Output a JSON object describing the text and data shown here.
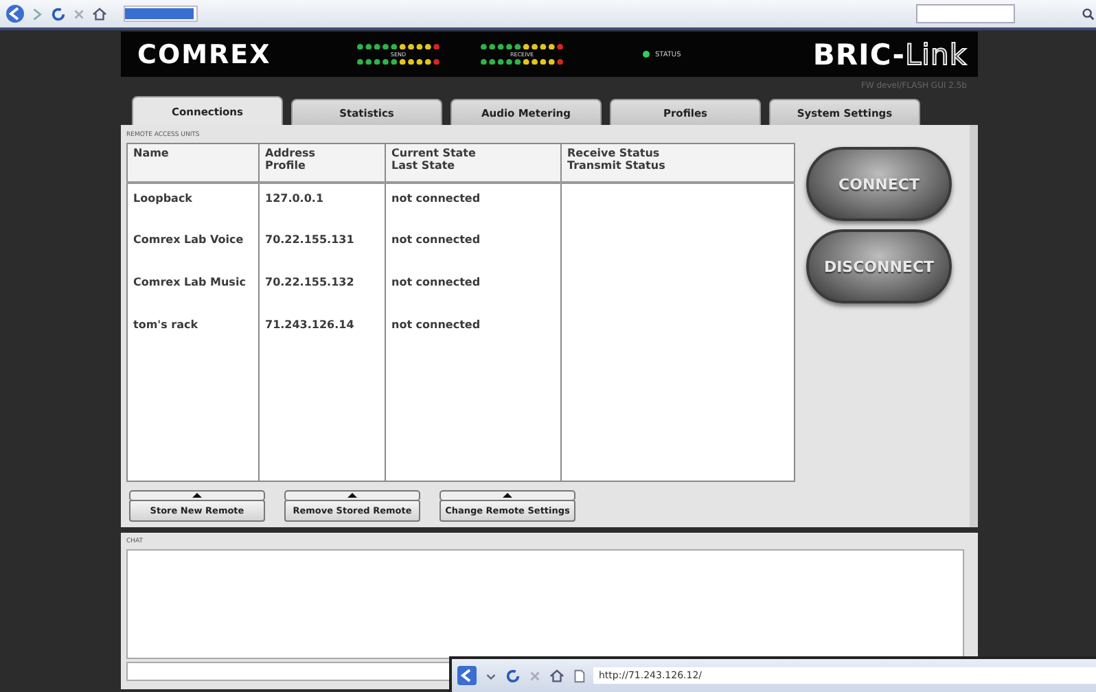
{
  "header": {
    "left_logo": "COMREX",
    "right_logo_main": "BRIC-",
    "right_logo_tail": "Link",
    "meters": [
      {
        "label": "SEND"
      },
      {
        "label": "RECEIVE"
      }
    ],
    "status": {
      "label": "STATUS",
      "on": true
    }
  },
  "version": "FW devel/FLASH GUI 2.5b",
  "tabs": [
    {
      "label": "Connections",
      "selected": true
    },
    {
      "label": "Statistics",
      "selected": false
    },
    {
      "label": "Audio Metering",
      "selected": false
    },
    {
      "label": "Profiles",
      "selected": false
    },
    {
      "label": "System Settings",
      "selected": false
    }
  ],
  "remote_units": {
    "title": "REMOTE ACCESS UNITS",
    "columns": [
      {
        "lines": [
          "Name"
        ]
      },
      {
        "lines": [
          "Address",
          "Profile"
        ]
      },
      {
        "lines": [
          "Current State",
          "Last State"
        ]
      },
      {
        "lines": [
          "Receive Status",
          "Transmit Status"
        ]
      }
    ],
    "rows": [
      {
        "cells": [
          "Loopback",
          "127.0.0.1",
          "not connected"
        ]
      },
      {
        "cells": [
          "Comrex Lab Voice",
          "70.22.155.131",
          "not connected"
        ]
      },
      {
        "cells": [
          "Comrex Lab Music",
          "70.22.155.132",
          "not connected"
        ]
      },
      {
        "cells": [
          "tom's rack",
          "71.243.126.14",
          "not connected"
        ]
      }
    ]
  },
  "connect_buttons": [
    "CONNECT",
    "DISCONNECT"
  ],
  "action_buttons": [
    "Store New Remote",
    "Remove Stored Remote",
    "Change Remote Settings"
  ],
  "chat": {
    "title": "CHAT"
  },
  "second_browser": {
    "url": "http://71.243.126.12/"
  }
}
